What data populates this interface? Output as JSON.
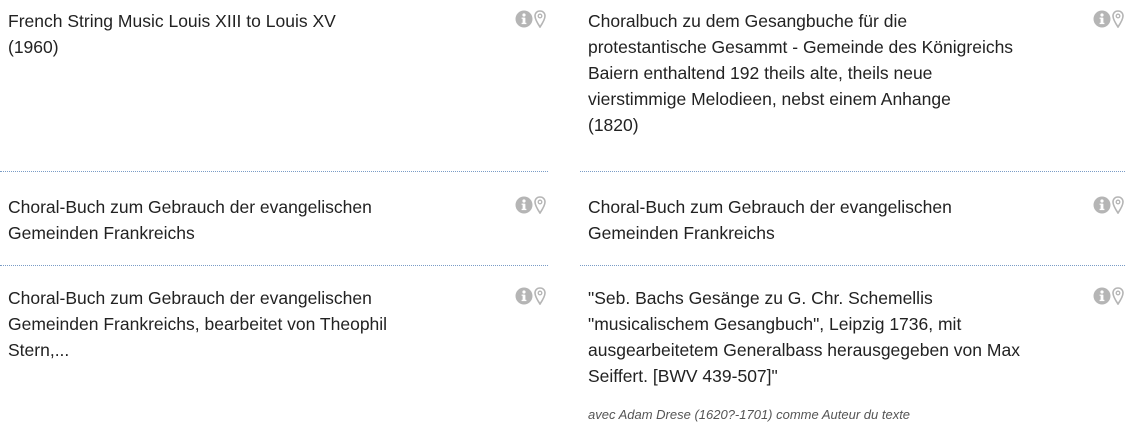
{
  "colors": {
    "text": "#222222",
    "icon": "#b5b5b5",
    "divider": "#7a9cc6",
    "subtitle": "#555555"
  },
  "results": {
    "left": [
      {
        "title_lines": [
          "French String Music Louis XIII to Louis XV",
          "(1960)"
        ],
        "icons": [
          "info-icon",
          "map-pin-icon"
        ]
      },
      {
        "title_lines": [
          "Choral-Buch zum Gebrauch der evangelischen",
          "Gemeinden Frankreichs"
        ],
        "icons": [
          "info-icon",
          "map-pin-icon"
        ]
      },
      {
        "title_lines": [
          "Choral-Buch zum Gebrauch der evangelischen",
          "Gemeinden Frankreichs, bearbeitet von Theophil",
          "Stern,..."
        ],
        "icons": [
          "info-icon",
          "map-pin-icon"
        ]
      }
    ],
    "right": [
      {
        "title_lines": [
          "Choralbuch zu dem Gesangbuche für die",
          "protestantische Gesammt - Gemeinde des Königreichs",
          "Baiern enthaltend 192 theils alte, theils neue",
          "vierstimmige Melodieen, nebst einem Anhange",
          "(1820)"
        ],
        "icons": [
          "info-icon",
          "map-pin-icon"
        ]
      },
      {
        "title_lines": [
          "Choral-Buch zum Gebrauch der evangelischen",
          "Gemeinden Frankreichs"
        ],
        "icons": [
          "info-icon",
          "map-pin-icon"
        ]
      },
      {
        "title_lines": [
          "\"Seb. Bachs Gesänge zu G. Chr. Schemellis",
          "\"musicalischem Gesangbuch\", Leipzig 1736, mit",
          "ausgearbeitetem Generalbass herausgegeben von Max",
          "Seiffert. [BWV 439-507]\""
        ],
        "subtitle": "avec Adam Drese (1620?-1701) comme Auteur du texte",
        "icons": [
          "info-icon",
          "map-pin-icon"
        ]
      }
    ]
  }
}
